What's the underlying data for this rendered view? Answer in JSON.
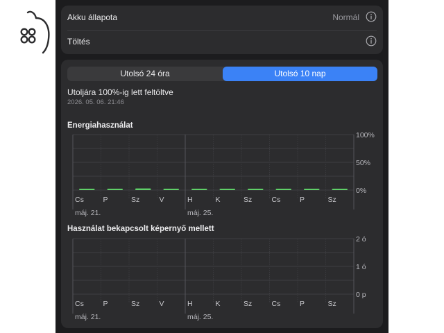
{
  "battery": {
    "state_label": "Akku állapota",
    "state_value": "Normál",
    "charging_label": "Töltés"
  },
  "tabs": [
    {
      "label": "Utolsó 24 óra",
      "selected": false
    },
    {
      "label": "Utolsó 10 nap",
      "selected": true
    }
  ],
  "last_charged": {
    "text": "Utoljára 100%-ig lett feltöltve",
    "time": "2026. 05. 06. 21:46"
  },
  "colors": {
    "accent": "#3b82f6",
    "bar": "#5fd068"
  },
  "chart_data": [
    {
      "type": "bar",
      "title": "Energiahasználat",
      "categories": [
        "Cs",
        "P",
        "Sz",
        "V",
        "H",
        "K",
        "Sz",
        "Cs",
        "P",
        "Sz"
      ],
      "week_labels": [
        {
          "index": 0,
          "text": "máj. 21."
        },
        {
          "index": 4,
          "text": "máj. 25."
        }
      ],
      "values": [
        2,
        2,
        3,
        1.5,
        2,
        1.5,
        2,
        2,
        2,
        1
      ],
      "ylim": [
        0,
        100
      ],
      "yticks": [
        "0%",
        "50%",
        "100%"
      ],
      "grid": true
    },
    {
      "type": "bar",
      "title": "Használat bekapcsolt képernyő mellett",
      "categories": [
        "Cs",
        "P",
        "Sz",
        "V",
        "H",
        "K",
        "Sz",
        "Cs",
        "P",
        "Sz"
      ],
      "week_labels": [
        {
          "index": 0,
          "text": "máj. 21."
        },
        {
          "index": 4,
          "text": "máj. 25."
        }
      ],
      "values": [
        0,
        0,
        0,
        0,
        0,
        0,
        0,
        0,
        0,
        0
      ],
      "ylim": [
        0,
        2
      ],
      "yticks": [
        "0 p",
        "1 ó",
        "2 ó"
      ],
      "grid": true
    }
  ]
}
